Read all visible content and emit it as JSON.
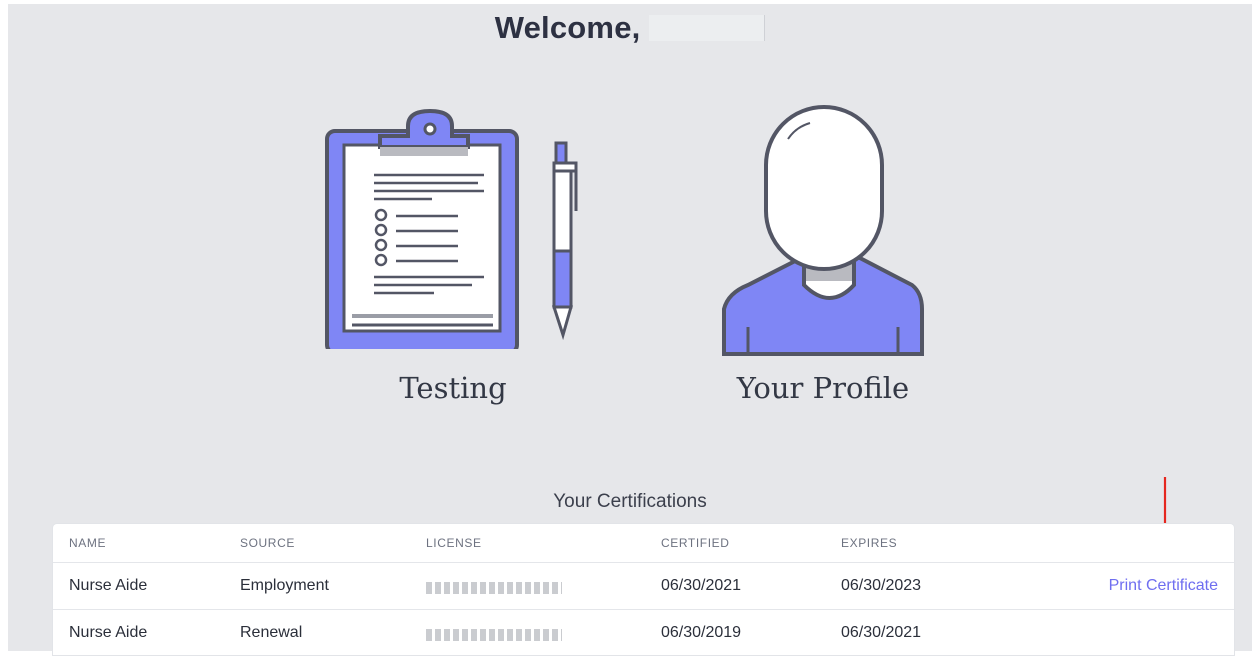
{
  "header": {
    "welcome": "Welcome,"
  },
  "tiles": [
    {
      "label": "Testing",
      "icon": "clipboard-icon"
    },
    {
      "label": "Your Profile",
      "icon": "profile-avatar-icon"
    }
  ],
  "certifications": {
    "heading": "Your Certifications",
    "columns": [
      "NAME",
      "SOURCE",
      "LICENSE",
      "CERTIFIED",
      "EXPIRES"
    ],
    "rows": [
      {
        "name": "Nurse Aide",
        "source": "Employment",
        "license": "",
        "certified": "06/30/2021",
        "expires": "06/30/2023",
        "action": "Print Certificate"
      },
      {
        "name": "Nurse Aide",
        "source": "Renewal",
        "license": "",
        "certified": "06/30/2019",
        "expires": "06/30/2021",
        "action": ""
      }
    ]
  },
  "colors": {
    "accent": "#7f86f5",
    "link": "#6f6ef0",
    "annotation_arrow": "#e5271f",
    "background": "#e6e7ea"
  }
}
